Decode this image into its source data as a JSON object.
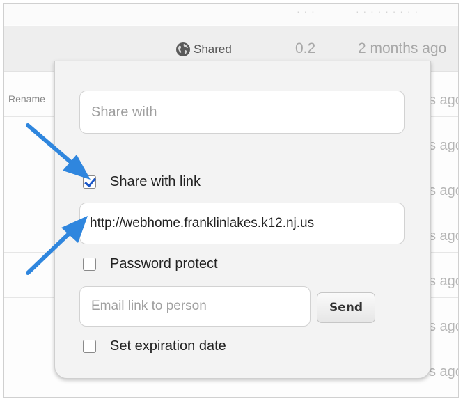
{
  "background_list": {
    "top_faint_left": "· · ·",
    "top_faint_right": "· · · · · · · · ·",
    "header": {
      "shared_label": "Shared",
      "version": "0.2",
      "modified": "2 months ago"
    },
    "rename_label": "Rename",
    "row_age_fragment": "s ago"
  },
  "share_popup": {
    "share_with_placeholder": "Share with",
    "share_with_link_label": "Share with link",
    "share_with_link_checked": true,
    "link_url": "http://webhome.franklinlakes.k12.nj.us",
    "password_protect_label": "Password protect",
    "password_protect_checked": false,
    "email_placeholder": "Email link to person",
    "send_label": "Send",
    "expiration_label": "Set expiration date",
    "expiration_checked": false
  },
  "colors": {
    "annotation_arrow": "#2f86de",
    "checkbox_check": "#1a56c8"
  },
  "icons": {
    "shared": "globe-icon"
  }
}
